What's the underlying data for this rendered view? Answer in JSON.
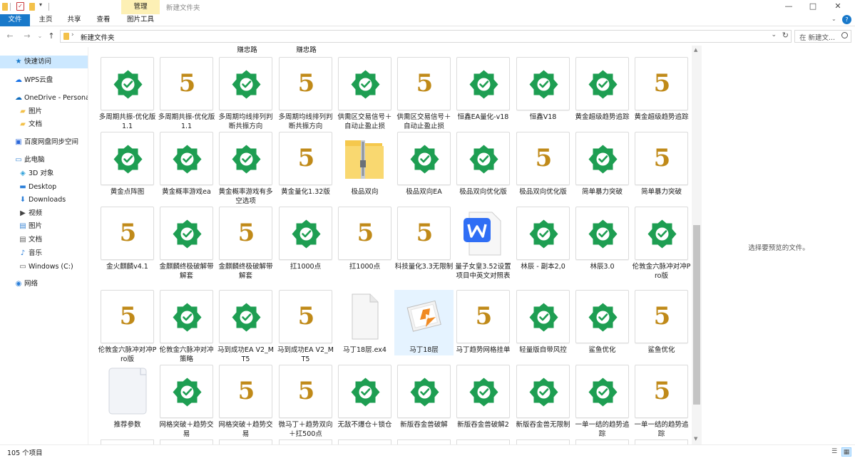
{
  "titlebar": {
    "manage_tab": "管理",
    "window_title": "新建文件夹",
    "minimize": "—",
    "maximize": "□",
    "close": "✕"
  },
  "ribbon": {
    "tabs": [
      "文件",
      "主页",
      "共享",
      "查看",
      "图片工具"
    ],
    "help": "?"
  },
  "address": {
    "path": "新建文件夹",
    "search_placeholder": "在 新建文..."
  },
  "nav": [
    {
      "label": "快速访问",
      "icon": "star-icon",
      "sel": true
    },
    {
      "label": "WPS云盘",
      "icon": "cloud-icon"
    },
    {
      "label": "OneDrive - Persona",
      "icon": "onedrive-icon"
    },
    {
      "label": "图片",
      "icon": "folder-icon"
    },
    {
      "label": "文档",
      "icon": "folder-icon"
    },
    {
      "label": "百度网盘同步空间",
      "icon": "baidu-icon"
    },
    {
      "label": "此电脑",
      "icon": "computer-icon"
    },
    {
      "label": "3D 对象",
      "icon": "cube-icon"
    },
    {
      "label": "Desktop",
      "icon": "desktop-icon"
    },
    {
      "label": "Downloads",
      "icon": "download-icon"
    },
    {
      "label": "视频",
      "icon": "video-icon"
    },
    {
      "label": "图片",
      "icon": "picture-icon"
    },
    {
      "label": "文档",
      "icon": "document-icon"
    },
    {
      "label": "音乐",
      "icon": "music-icon"
    },
    {
      "label": "Windows (C:)",
      "icon": "drive-icon"
    },
    {
      "label": "网络",
      "icon": "network-icon"
    }
  ],
  "content": {
    "partial_labels": [
      "赚忠路",
      "赚忠路"
    ],
    "rows": [
      [
        {
          "type": "gear",
          "label": "多周期共振-优化版1.1"
        },
        {
          "type": "five",
          "label": "多周期共振-优化版1.1"
        },
        {
          "type": "gear",
          "label": "多周期均线排列判断共振方向"
        },
        {
          "type": "five",
          "label": "多周期均线排列判断共振方向"
        },
        {
          "type": "gear",
          "label": "供需区交易信号＋自动止盈止损"
        },
        {
          "type": "five",
          "label": "供需区交易信号＋自动止盈止损"
        },
        {
          "type": "gear",
          "label": "恒鑫EA量化-v18"
        },
        {
          "type": "gear",
          "label": "恒鑫V18"
        },
        {
          "type": "gear",
          "label": "黄金超级趋势追踪"
        },
        {
          "type": "five",
          "label": "黄金超级趋势追踪"
        }
      ],
      [
        {
          "type": "gear",
          "label": "黄金点阵图"
        },
        {
          "type": "gear",
          "label": "黄金概率游戏ea"
        },
        {
          "type": "gear",
          "label": "黄金概率游戏有多空选项"
        },
        {
          "type": "five",
          "label": "黄金量化1.32版"
        },
        {
          "type": "zip",
          "label": "极品双向"
        },
        {
          "type": "gear",
          "label": "极品双向EA"
        },
        {
          "type": "gear",
          "label": "极品双向优化版"
        },
        {
          "type": "five",
          "label": "极品双向优化版"
        },
        {
          "type": "gear",
          "label": "简单暴力突破"
        },
        {
          "type": "five",
          "label": "简单暴力突破"
        }
      ],
      [
        {
          "type": "five",
          "label": "金火麒麟v4.1"
        },
        {
          "type": "gear",
          "label": "金麒麟终极破解带解套"
        },
        {
          "type": "five",
          "label": "金麒麟终极破解带解套"
        },
        {
          "type": "gear",
          "label": "扛1000点"
        },
        {
          "type": "five",
          "label": "扛1000点"
        },
        {
          "type": "five",
          "label": "科技量化3.3无限制"
        },
        {
          "type": "wps",
          "label": "量子女皇3.52设置项目中英文对照表"
        },
        {
          "type": "gear",
          "label": "林辰 - 副本2,0"
        },
        {
          "type": "gear",
          "label": "林辰3.0"
        },
        {
          "type": "gear",
          "label": "伦敦金六脉冲对冲Pro版"
        }
      ],
      [
        {
          "type": "five",
          "label": "伦敦金六脉冲对冲Pro版"
        },
        {
          "type": "gear",
          "label": "伦敦金六脉冲对冲策略"
        },
        {
          "type": "gear",
          "label": "马到成功EA V2_MT5"
        },
        {
          "type": "five",
          "label": "马到成功EA V2_MT5"
        },
        {
          "type": "blank",
          "label": "马丁18层.ex4"
        },
        {
          "type": "img",
          "label": "马丁18层",
          "sel": true
        },
        {
          "type": "five",
          "label": "马丁趋势网格挂单"
        },
        {
          "type": "gear",
          "label": "轻量版自带风控"
        },
        {
          "type": "gear",
          "label": "鲨鱼优化"
        },
        {
          "type": "five",
          "label": "鲨鱼优化"
        }
      ],
      [
        {
          "type": "doc",
          "label": "推荐参数"
        },
        {
          "type": "gear",
          "label": "网格突破＋趋势交易"
        },
        {
          "type": "five",
          "label": "网格突破＋趋势交易"
        },
        {
          "type": "five",
          "label": "微马丁＋趋势双向＋扛500点"
        },
        {
          "type": "gear",
          "label": "无敌不爆仓＋锁仓"
        },
        {
          "type": "gear",
          "label": "新版吞金兽破解"
        },
        {
          "type": "gear",
          "label": "新版吞金兽破解2"
        },
        {
          "type": "gear",
          "label": "新版吞金兽无限制"
        },
        {
          "type": "gear",
          "label": "一单一结的趋势追踪"
        },
        {
          "type": "five",
          "label": "一单一结的趋势追踪"
        }
      ]
    ]
  },
  "preview": {
    "message": "选择要预览的文件。"
  },
  "status": {
    "count": "105 个项目"
  },
  "colors": {
    "accent": "#1979ca",
    "gear_green": "#1e9e52",
    "five_gold": "#c08a19",
    "manage_tab_bg": "#fdf0b5",
    "selection": "#cce8ff"
  }
}
